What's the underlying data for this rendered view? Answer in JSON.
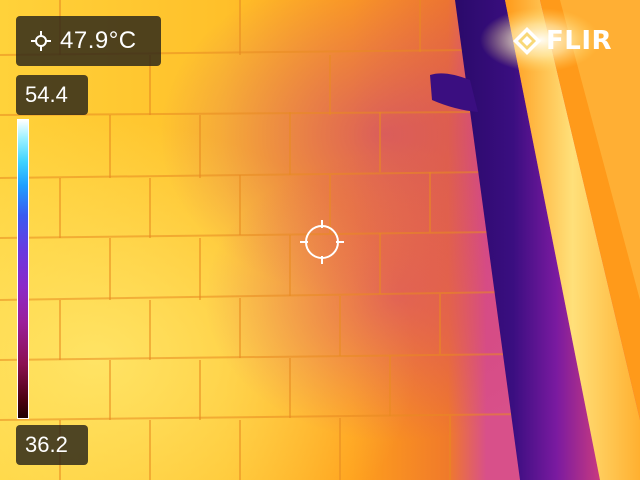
{
  "camera": {
    "brand": "FLIR",
    "palette": "iron",
    "spot_meter": {
      "icon": "crosshair-spot-icon",
      "value": "47.9°C"
    },
    "scale": {
      "max_label": "54.4",
      "min_label": "36.2"
    },
    "colors": {
      "overlay_bg": "#28231a",
      "text": "#ffffff",
      "hot": "#ffe15a",
      "warm": "#ff9a1a",
      "cool": "#c2249c",
      "cold": "#2a0a6a"
    }
  }
}
